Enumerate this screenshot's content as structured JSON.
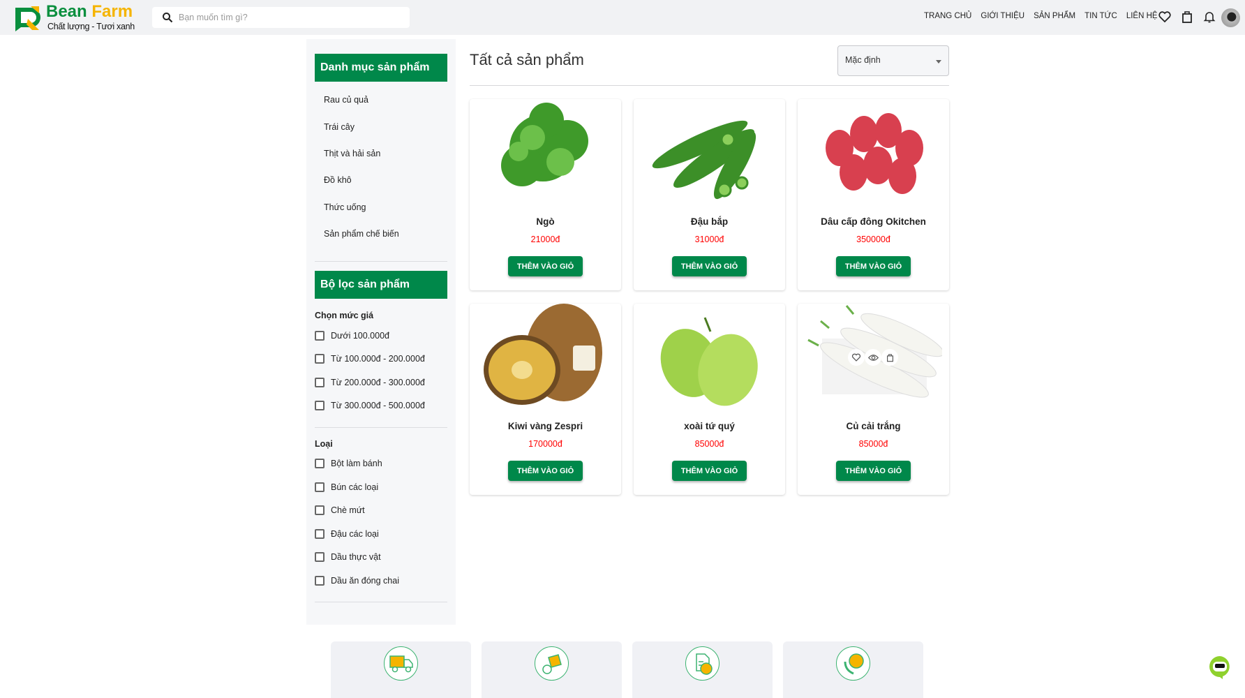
{
  "header": {
    "logo": {
      "brand_1": "Bean",
      "brand_2": "Farm",
      "tagline": "Chất lượng - Tươi xanh"
    },
    "search_placeholder": "Bạn muốn tìm gì?",
    "nav": [
      "TRANG CHỦ",
      "GIỚI THIỆU",
      "SẢN PHẨM",
      "TIN TỨC",
      "LIÊN HỆ"
    ],
    "icons": [
      "heart-icon",
      "shopping-bag-icon",
      "bell-icon",
      "avatar"
    ]
  },
  "sidebar": {
    "categories_title": "Danh mục sản phẩm",
    "categories": [
      "Rau củ quả",
      "Trái cây",
      "Thịt và hải sản",
      "Đồ khô",
      "Thức uống",
      "Sản phẩm chế biến"
    ],
    "filter_title": "Bộ lọc sản phẩm",
    "price_group": "Chọn mức giá",
    "prices": [
      "Dưới 100.000đ",
      "Từ 100.000đ - 200.000đ",
      "Từ 200.000đ - 300.000đ",
      "Từ 300.000đ - 500.000đ"
    ],
    "type_group": "Loại",
    "types": [
      "Bột làm bánh",
      "Bún các loại",
      "Chè mứt",
      "Đậu các loại",
      "Dầu thực vật",
      "Dầu ăn đóng chai"
    ]
  },
  "main": {
    "title": "Tất cả sản phẩm",
    "sort_selected": "Mặc định",
    "add_to_cart": "THÊM VÀO GIỎ",
    "products": [
      {
        "name": "Ngò",
        "price": "21000đ"
      },
      {
        "name": "Đậu bắp",
        "price": "31000đ"
      },
      {
        "name": "Dâu cấp đông Okitchen",
        "price": "350000đ"
      },
      {
        "name": "Kiwi vàng Zespri",
        "price": "170000đ"
      },
      {
        "name": "xoài tứ quý",
        "price": "85000đ"
      },
      {
        "name": "Củ cải trắng",
        "price": "85000đ"
      }
    ]
  },
  "features": [
    "free-shipping-icon",
    "return-box-icon",
    "payment-icon",
    "support-24-icon"
  ],
  "colors": {
    "primary": "#00884a",
    "price": "#ff0000",
    "accent": "#f5b400"
  }
}
